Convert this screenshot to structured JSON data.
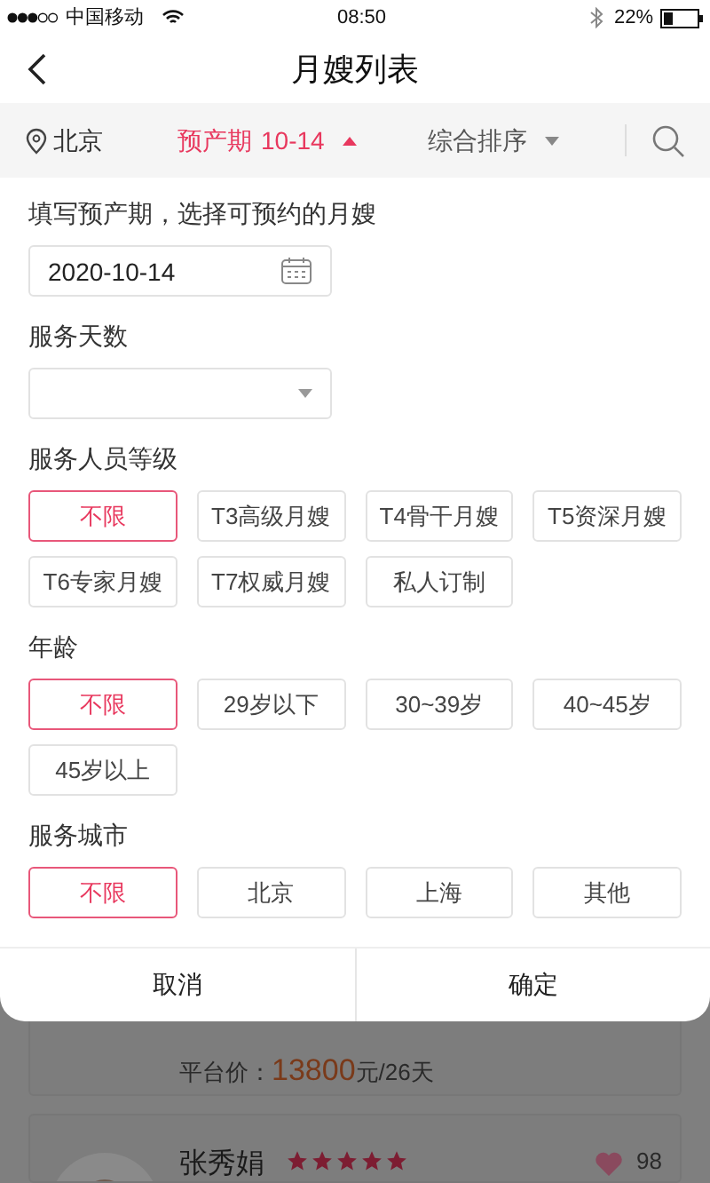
{
  "status_bar": {
    "carrier": "中国移动",
    "time": "08:50",
    "battery": "22%"
  },
  "header": {
    "title": "月嫂列表"
  },
  "filter_bar": {
    "location": "北京",
    "due_date_label": "预产期",
    "due_date": "10-14",
    "sort": "综合排序"
  },
  "date_section": {
    "label": "填写预产期，选择可预约的月嫂",
    "value": "2020-10-14"
  },
  "days_section": {
    "label": "服务天数"
  },
  "chip_sections": [
    {
      "label": "服务人员等级",
      "options": [
        {
          "label": "不限",
          "selected": true
        },
        {
          "label": "T3高级月嫂",
          "selected": false
        },
        {
          "label": "T4骨干月嫂",
          "selected": false
        },
        {
          "label": "T5资深月嫂",
          "selected": false
        },
        {
          "label": "T6专家月嫂",
          "selected": false
        },
        {
          "label": "T7权威月嫂",
          "selected": false
        },
        {
          "label": "私人订制",
          "selected": false
        }
      ]
    },
    {
      "label": "年龄",
      "options": [
        {
          "label": "不限",
          "selected": true
        },
        {
          "label": "29岁以下",
          "selected": false
        },
        {
          "label": "30~39岁",
          "selected": false
        },
        {
          "label": "40~45岁",
          "selected": false
        },
        {
          "label": "45岁以上",
          "selected": false
        }
      ]
    },
    {
      "label": "服务城市",
      "options": [
        {
          "label": "不限",
          "selected": true
        },
        {
          "label": "北京",
          "selected": false
        },
        {
          "label": "上海",
          "selected": false
        },
        {
          "label": "其他",
          "selected": false
        }
      ]
    }
  ],
  "actions": {
    "cancel": "取消",
    "confirm": "确定"
  },
  "background_list": {
    "price_label": "平台价：",
    "price": "13800",
    "price_unit": "元/26天",
    "caregiver": {
      "name": "张秀娟",
      "stars": 5,
      "likes": "98"
    }
  }
}
